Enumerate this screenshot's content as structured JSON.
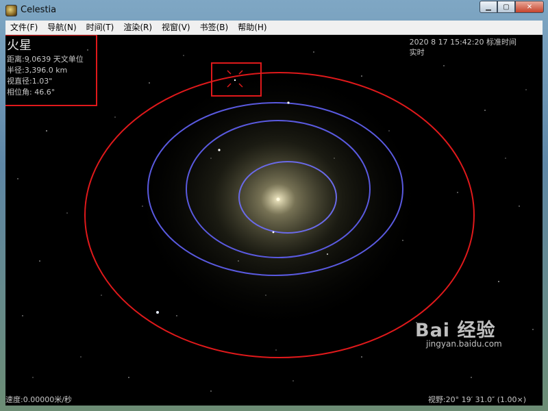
{
  "window": {
    "title": "Celestia",
    "controls": {
      "minimize": "▁",
      "maximize": "▢",
      "close": "✕"
    }
  },
  "menu": [
    {
      "label": "文件(F)"
    },
    {
      "label": "导航(N)"
    },
    {
      "label": "时间(T)"
    },
    {
      "label": "渲染(R)"
    },
    {
      "label": "视窗(V)"
    },
    {
      "label": "书签(B)"
    },
    {
      "label": "帮助(H)"
    }
  ],
  "object_info": {
    "name": "火星",
    "distance": "距离:9.0639 天文单位",
    "radius": "半径:3,396.0 km",
    "apparent_diameter": "视直径:1.03\"",
    "phase_angle": "相位角: 46.6°"
  },
  "time_display": {
    "datetime": "2020 8 17 15:42:20 标准时间",
    "mode": "实时"
  },
  "speed": "速度:0.00000米/秒",
  "fov": "视野:20° 19′ 31.0″ (1.00×)",
  "watermark": {
    "brand": "Bai 经验",
    "sub": "jingyan.baidu.com"
  },
  "colors": {
    "orbit_inner": "#5a5ae0",
    "orbit_selected": "#e0191b",
    "highlight_box": "#e0191b",
    "space": "#000000"
  }
}
